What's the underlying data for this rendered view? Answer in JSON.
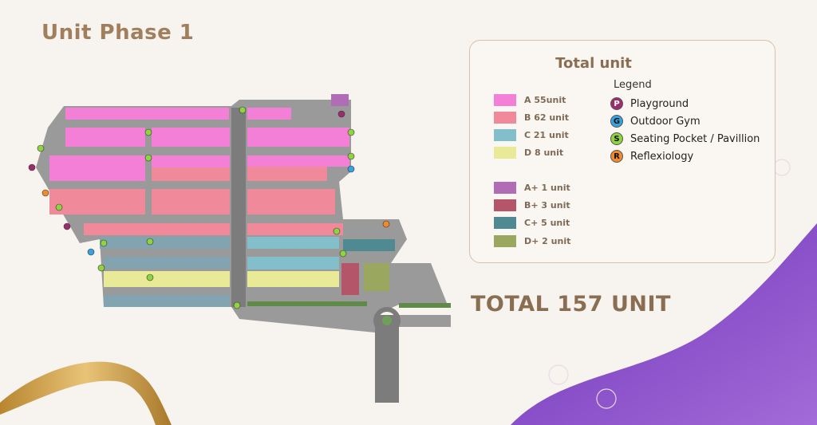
{
  "page_title": "Unit Phase 1",
  "total_label": "TOTAL 157 UNIT",
  "panel": {
    "title": "Total unit",
    "units": [
      {
        "label": "A 55unit",
        "color": "#f47fd6"
      },
      {
        "label": "B 62 unit",
        "color": "#f08a9a"
      },
      {
        "label": "C 21 unit",
        "color": "#82bfca"
      },
      {
        "label": "D 8 unit",
        "color": "#e9ea98"
      },
      {
        "label": "A+ 1 unit",
        "color": "#b06cb4"
      },
      {
        "label": "B+ 3 unit",
        "color": "#b4556a"
      },
      {
        "label": "C+ 5 unit",
        "color": "#4f8a92"
      },
      {
        "label": "D+ 2 unit",
        "color": "#9aa75e"
      }
    ],
    "legend_title": "Legend",
    "legend": [
      {
        "letter": "P",
        "label": "Playground",
        "color": "#9c2d6c"
      },
      {
        "letter": "G",
        "label": "Outdoor Gym",
        "color": "#36a3e0"
      },
      {
        "letter": "S",
        "label": "Seating Pocket / Pavillion",
        "color": "#8fd33f"
      },
      {
        "letter": "R",
        "label": "Reflexiology",
        "color": "#f08a2c"
      }
    ]
  },
  "colors": {
    "accent": "#a17f5c",
    "purple": "#7a3fc2",
    "gold": "#c99a4a"
  }
}
